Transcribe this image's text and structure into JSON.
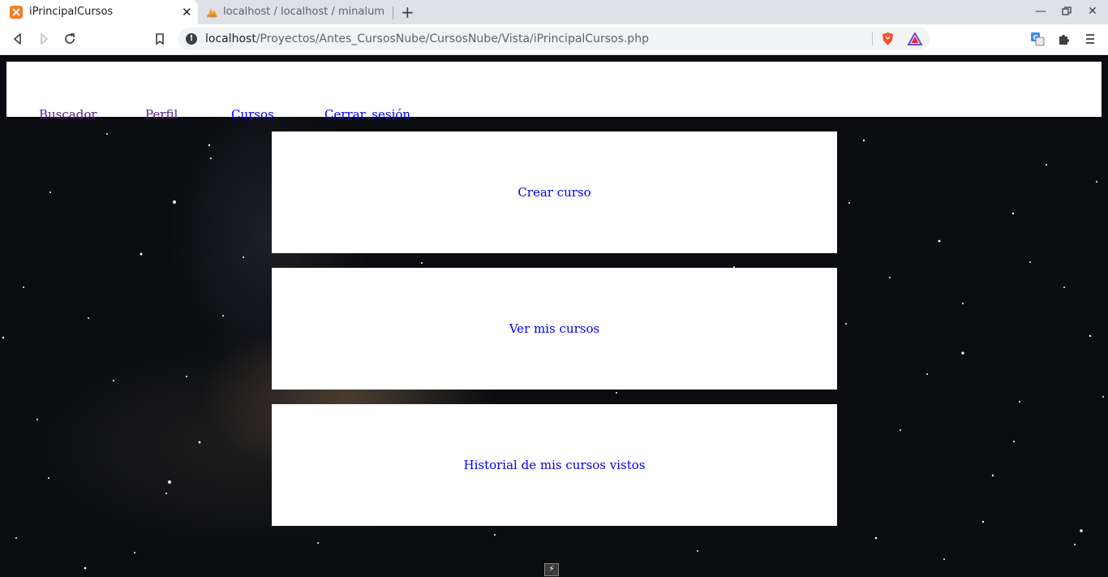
{
  "browser": {
    "tabs": [
      {
        "title": "iPrincipalCursos",
        "active": true,
        "icon": "xampp-icon"
      },
      {
        "title": "localhost / localhost / minalum",
        "active": false,
        "icon": "phpmyadmin-icon"
      }
    ],
    "close_symbol": "✕",
    "new_tab_symbol": "+",
    "url_host": "localhost",
    "url_path": "/Proyectos/Antes_CursosNube/CursosNube/Vista/iPrincipalCursos.php",
    "info_symbol": "!"
  },
  "nav": {
    "items": [
      {
        "label": "Buscador",
        "state": "visited"
      },
      {
        "label": "Perfil",
        "state": "visited"
      },
      {
        "label": "Cursos",
        "state": "link"
      },
      {
        "label": "Cerrar_sesión",
        "state": "link"
      }
    ]
  },
  "cards": [
    {
      "label": "Crear curso"
    },
    {
      "label": "Ver mis cursos"
    },
    {
      "label": "Historial de mis cursos vistos"
    }
  ],
  "colors": {
    "link": "#0000ee",
    "visited": "#551a8b",
    "tabstrip": "#dee1e6"
  }
}
